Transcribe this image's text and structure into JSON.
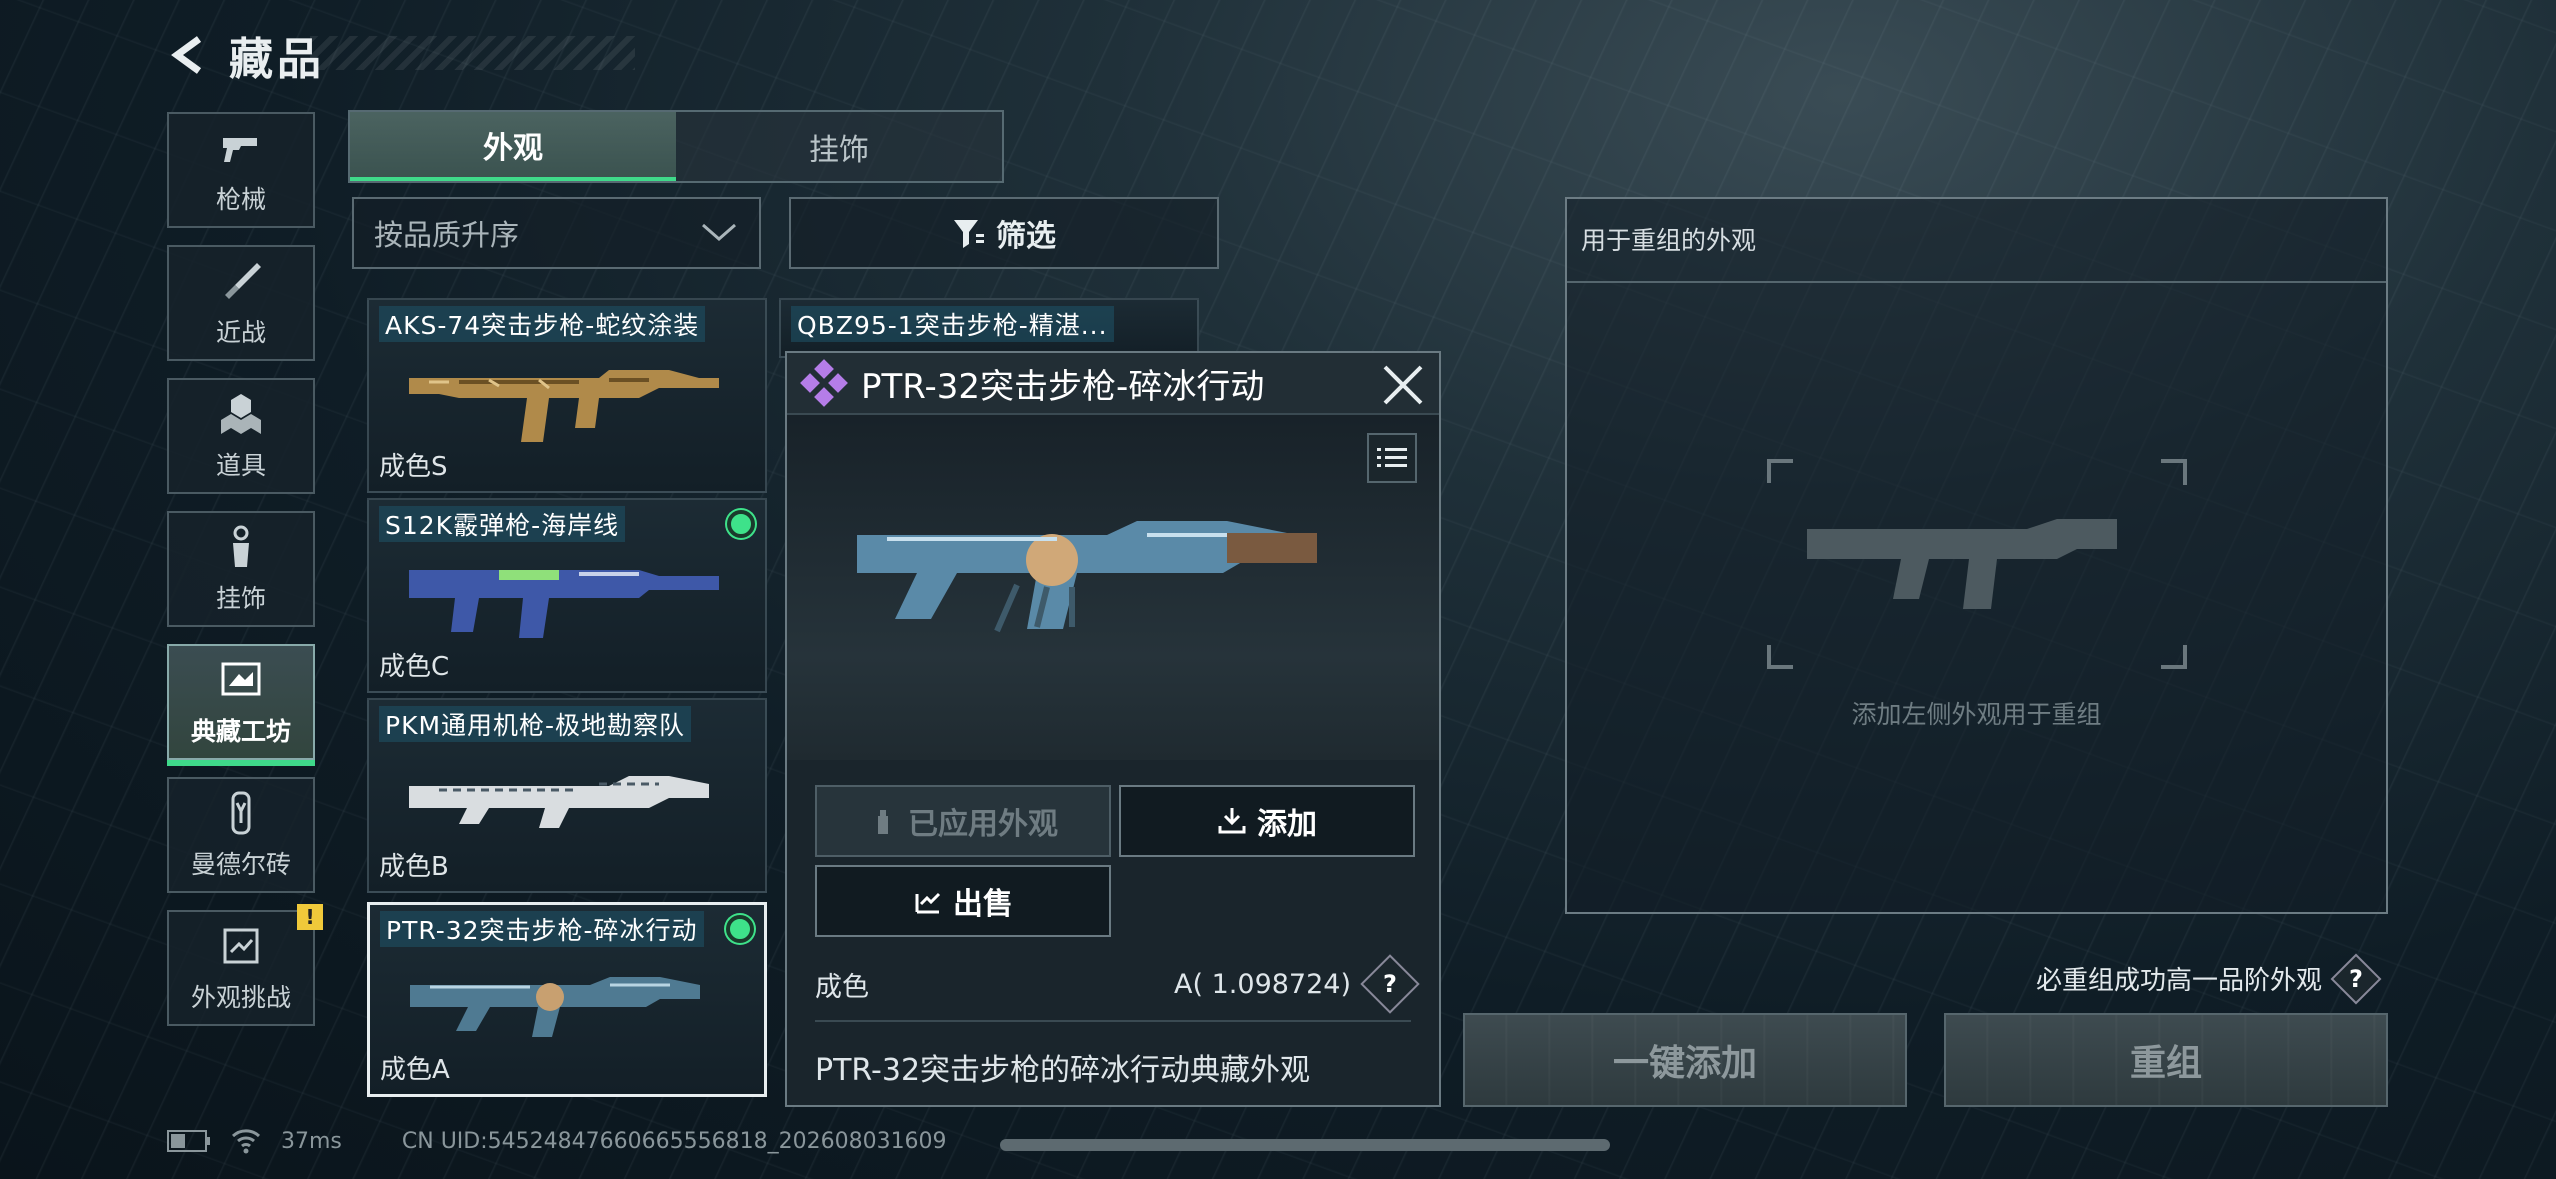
{
  "header": {
    "title": "藏品"
  },
  "sidebar": {
    "items": [
      {
        "label": "枪械",
        "icon": "gun-icon"
      },
      {
        "label": "近战",
        "icon": "knife-icon"
      },
      {
        "label": "道具",
        "icon": "grenade-icon"
      },
      {
        "label": "挂饰",
        "icon": "charm-icon"
      },
      {
        "label": "典藏工坊",
        "icon": "workshop-icon",
        "active": true
      },
      {
        "label": "曼德尔砖",
        "icon": "brick-icon"
      },
      {
        "label": "外观挑战",
        "icon": "challenge-icon",
        "badge": "!"
      }
    ]
  },
  "tabs": [
    {
      "label": "外观",
      "active": true
    },
    {
      "label": "挂饰"
    }
  ],
  "sort": {
    "label": "按品质升序"
  },
  "filter": {
    "label": "筛选"
  },
  "cards": [
    {
      "name": "AKS-74突击步枪-蛇纹涂装",
      "grade": "成色S"
    },
    {
      "name": "QBZ95-1突击步枪-精湛..."
    },
    {
      "name": "S12K霰弹枪-海岸线",
      "grade": "成色C",
      "equipped": true
    },
    {
      "name": "PKM通用机枪-极地勘察队",
      "grade": "成色B"
    },
    {
      "name": "PTR-32突击步枪-碎冰行动",
      "grade": "成色A",
      "equipped": true,
      "selected": true
    }
  ],
  "popup": {
    "title": "PTR-32突击步枪-碎冰行动",
    "applied_label": "已应用外观",
    "add_label": "添加",
    "sell_label": "出售",
    "grade_label": "成色",
    "grade_value": "A( 1.098724)",
    "help": "?",
    "description": "PTR-32突击步枪的碎冰行动典藏外观"
  },
  "recombine": {
    "title": "用于重组的外观",
    "hint": "添加左侧外观用于重组",
    "note": "必重组成功高一品阶外观",
    "help": "?",
    "one_click_label": "一键添加",
    "recombine_label": "重组"
  },
  "footer": {
    "ping": "37ms",
    "uid": "CN UID:545248476606655568​18_202608031609"
  },
  "colors": {
    "accent": "#3fd98a",
    "warn": "#f0c93a"
  }
}
